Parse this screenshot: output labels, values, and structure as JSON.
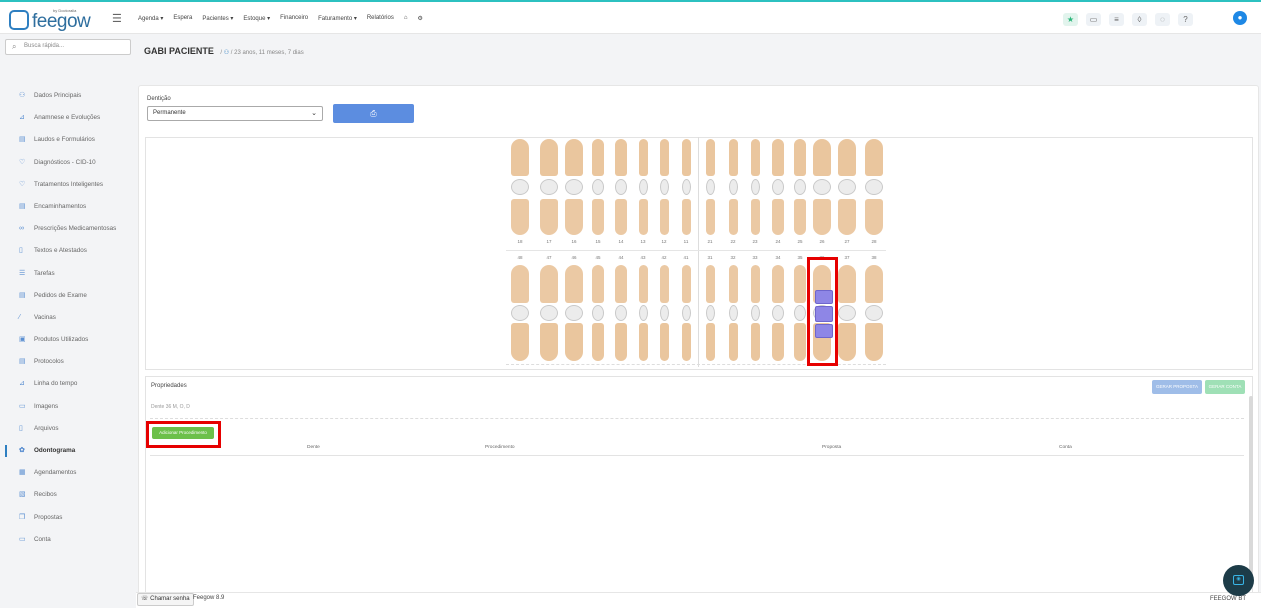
{
  "topbar": {
    "logo_text": "feegow",
    "logo_by": "by Doctoralia",
    "menu": [
      "Agenda ▾",
      "Espera",
      "Pacientes ▾",
      "Estoque ▾",
      "Financeiro",
      "Faturamento ▾",
      "Relatórios"
    ]
  },
  "search": {
    "placeholder": "Busca rápida..."
  },
  "patient": {
    "name": "GABI PACIENTE",
    "age": "23 anos, 11 meses, 7 dias"
  },
  "sidebar": {
    "items": [
      {
        "label": "Dados Principais",
        "icon": "user-icon"
      },
      {
        "label": "Anamnese e Evoluções",
        "icon": "chart-icon"
      },
      {
        "label": "Laudos e Formulários",
        "icon": "document-icon"
      },
      {
        "label": "Diagnósticos - CID-10",
        "icon": "stethoscope-icon"
      },
      {
        "label": "Tratamentos Inteligentes",
        "icon": "stethoscope-icon"
      },
      {
        "label": "Encaminhamentos",
        "icon": "document-icon"
      },
      {
        "label": "Prescrições Medicamentosas",
        "icon": "pills-icon"
      },
      {
        "label": "Textos e Atestados",
        "icon": "file-icon"
      },
      {
        "label": "Tarefas",
        "icon": "list-icon"
      },
      {
        "label": "Pedidos de Exame",
        "icon": "clipboard-icon"
      },
      {
        "label": "Vacinas",
        "icon": "syringe-icon"
      },
      {
        "label": "Produtos Utilizados",
        "icon": "box-icon"
      },
      {
        "label": "Protocolos",
        "icon": "document-icon"
      },
      {
        "label": "Linha do tempo",
        "icon": "timeline-icon"
      },
      {
        "label": "Imagens",
        "icon": "image-icon"
      },
      {
        "label": "Arquivos",
        "icon": "file-icon"
      },
      {
        "label": "Odontograma",
        "icon": "tooth-icon"
      },
      {
        "label": "Agendamentos",
        "icon": "calendar-icon"
      },
      {
        "label": "Recibos",
        "icon": "receipt-icon"
      },
      {
        "label": "Propostas",
        "icon": "copy-icon"
      },
      {
        "label": "Conta",
        "icon": "money-icon"
      }
    ]
  },
  "odontograma": {
    "denticao_label": "Dentição",
    "denticao_value": "Permanente",
    "upper_numbers": [
      "18",
      "17",
      "16",
      "15",
      "14",
      "13",
      "12",
      "11",
      "21",
      "22",
      "23",
      "24",
      "25",
      "26",
      "27",
      "28"
    ],
    "lower_numbers": [
      "48",
      "47",
      "46",
      "45",
      "44",
      "43",
      "42",
      "41",
      "31",
      "32",
      "33",
      "34",
      "35",
      "36",
      "37",
      "38"
    ],
    "tooth_color": "#e8c094",
    "selected_color": "#8e86e6"
  },
  "properties": {
    "title": "Propriedades",
    "gerar_proposta": "GERAR PROPOSTA",
    "gerar_conta": "GERAR CONTA",
    "dente_info": "Dente 36 M, O, D",
    "add_button": "Adicionar Procedimento",
    "columns": [
      "Dente",
      "Procedimento",
      "Proposta",
      "Conta"
    ]
  },
  "footer": {
    "chamar": "Chamar senha",
    "version": "Feegow 8.9",
    "brand": "FEEGOW BT"
  }
}
